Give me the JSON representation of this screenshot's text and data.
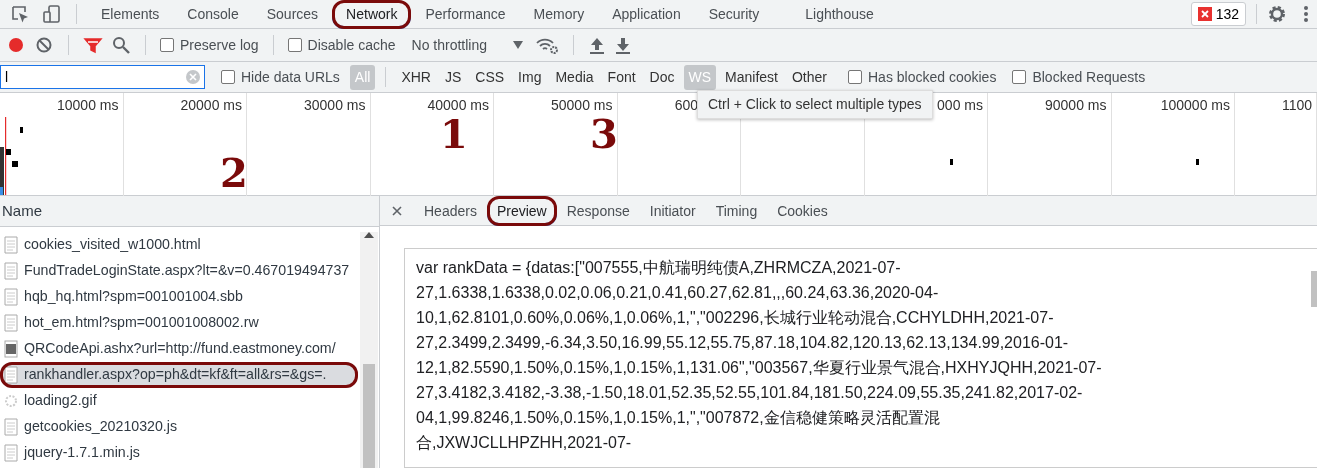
{
  "main_tabs": [
    {
      "label": "Elements",
      "selected": false,
      "circled": false
    },
    {
      "label": "Console",
      "selected": false,
      "circled": false
    },
    {
      "label": "Sources",
      "selected": false,
      "circled": false
    },
    {
      "label": "Network",
      "selected": true,
      "circled": true
    },
    {
      "label": "Performance",
      "selected": false,
      "circled": false
    },
    {
      "label": "Memory",
      "selected": false,
      "circled": false
    },
    {
      "label": "Application",
      "selected": false,
      "circled": false
    },
    {
      "label": "Security",
      "selected": false,
      "circled": false
    },
    {
      "label": "Lighthouse",
      "selected": false,
      "circled": false
    }
  ],
  "error_count": "132",
  "network_toolbar": {
    "recording": true,
    "filter_active": true,
    "preserve_log": {
      "label": "Preserve log",
      "checked": false
    },
    "disable_cache": {
      "label": "Disable cache",
      "checked": false
    },
    "throttling": "No throttling"
  },
  "filter": {
    "value": "l",
    "hide_data_urls": {
      "label": "Hide data URLs",
      "checked": false
    },
    "types": [
      {
        "label": "All",
        "selected": true
      },
      {
        "label": "XHR",
        "selected": false
      },
      {
        "label": "JS",
        "selected": false
      },
      {
        "label": "CSS",
        "selected": false
      },
      {
        "label": "Img",
        "selected": false
      },
      {
        "label": "Media",
        "selected": false
      },
      {
        "label": "Font",
        "selected": false
      },
      {
        "label": "Doc",
        "selected": false
      },
      {
        "label": "WS",
        "selected": true
      },
      {
        "label": "Manifest",
        "selected": false
      },
      {
        "label": "Other",
        "selected": false
      }
    ],
    "checkboxes": [
      {
        "label": "Has blocked cookies",
        "checked": false
      },
      {
        "label": "Blocked Requests",
        "checked": false
      }
    ]
  },
  "timeline": {
    "ticks": [
      "10000 ms",
      "20000 ms",
      "30000 ms",
      "40000 ms",
      "50000 ms",
      "600",
      "000 ms",
      "90000 ms",
      "100000 ms",
      "1100"
    ]
  },
  "tooltip": "Ctrl + Click to select multiple types",
  "requests": {
    "column": "Name",
    "rows": [
      {
        "name": "cookies_visited_w1000.html",
        "kind": "doc",
        "selected": false,
        "circled": false
      },
      {
        "name": "FundTradeLoginState.aspx?lt=&v=0.467019494737",
        "kind": "doc",
        "selected": false,
        "circled": false
      },
      {
        "name": "hqb_hq.html?spm=001001004.sbb",
        "kind": "doc",
        "selected": false,
        "circled": false
      },
      {
        "name": "hot_em.html?spm=001001008002.rw",
        "kind": "doc",
        "selected": false,
        "circled": false
      },
      {
        "name": "QRCodeApi.ashx?url=http://fund.eastmoney.com/",
        "kind": "image",
        "selected": false,
        "circled": false
      },
      {
        "name": "rankhandler.aspx?op=ph&dt=kf&ft=all&rs=&gs=.",
        "kind": "doc",
        "selected": true,
        "circled": true
      },
      {
        "name": "loading2.gif",
        "kind": "spinner",
        "selected": false,
        "circled": false
      },
      {
        "name": "getcookies_20210320.js",
        "kind": "doc",
        "selected": false,
        "circled": false
      },
      {
        "name": "jquery-1.7.1.min.js",
        "kind": "doc",
        "selected": false,
        "circled": false
      }
    ]
  },
  "detail": {
    "tabs": [
      {
        "label": "Headers",
        "selected": false,
        "circled": false
      },
      {
        "label": "Preview",
        "selected": true,
        "circled": true
      },
      {
        "label": "Response",
        "selected": false,
        "circled": false
      },
      {
        "label": "Initiator",
        "selected": false,
        "circled": false
      },
      {
        "label": "Timing",
        "selected": false,
        "circled": false
      },
      {
        "label": "Cookies",
        "selected": false,
        "circled": false
      }
    ],
    "preview_lines": [
      "var rankData = {datas:[\"007555,中航瑞明纯债A,ZHRMCZA,2021-07-",
      "27,1.6338,1.6338,0.02,0.06,0.21,0.41,60.27,62.81,,,60.24,63.36,2020-04-",
      "10,1,62.8101,0.60%,0.06%,1,0.06%,1,\",\"002296,长城行业轮动混合,CCHYLDHH,2021-07-",
      "27,2.3499,2.3499,-6.34,3.50,16.99,55.12,55.75,87.18,104.82,120.13,62.13,134.99,2016-01-",
      "12,1,82.5590,1.50%,0.15%,1,0.15%,1,131.06\",\"003567,华夏行业景气混合,HXHYJQHH,2021-07-",
      "27,3.4182,3.4182,-3.38,-1.50,18.01,52.35,52.55,101.84,181.50,224.09,55.35,241.82,2017-02-",
      "04,1,99.8246,1.50%,0.15%,1,0.15%,1,\",\"007872,金信稳健策略灵活配置混",
      "合,JXWJCLLHPZHH,2021-07-"
    ]
  },
  "annotations": [
    {
      "label": "1"
    },
    {
      "label": "3"
    },
    {
      "label": "2"
    }
  ]
}
